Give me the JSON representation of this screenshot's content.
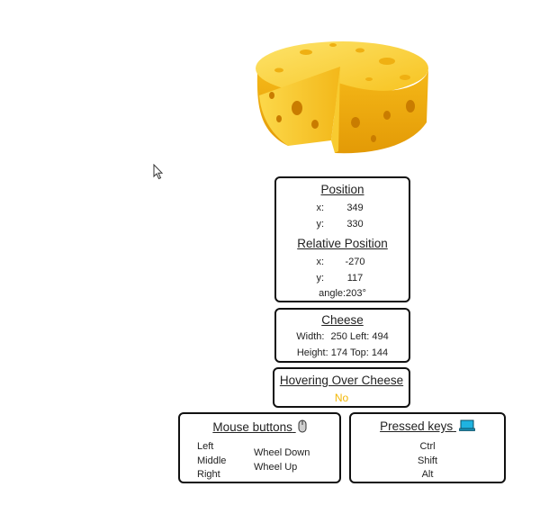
{
  "position": {
    "title": "Position",
    "x_label": "x:",
    "x": "349",
    "y_label": "y:",
    "y": "330"
  },
  "relative_position": {
    "title": "Relative Position",
    "x_label": "x:",
    "x": "-270",
    "y_label": "y:",
    "y": "117",
    "angle_label": "angle:",
    "angle": "203°"
  },
  "cheese": {
    "title": "Cheese",
    "width_label": "Width:",
    "width": "250",
    "left_label": "Left:",
    "left": "494",
    "height_label": "Height:",
    "height": "174",
    "top_label": "Top:",
    "top": "144"
  },
  "hover": {
    "title": "Hovering Over Cheese",
    "value": "No"
  },
  "mouse_buttons": {
    "title": "Mouse buttons",
    "icon": "mouse-icon",
    "left_column": [
      "Left",
      "Middle",
      "Right"
    ],
    "right_column": [
      "Wheel Down",
      "Wheel Up"
    ]
  },
  "pressed_keys": {
    "title": "Pressed keys",
    "icon": "keyboard-icon",
    "keys": [
      "Ctrl",
      "Shift",
      "Alt"
    ]
  },
  "colors": {
    "cheese_yellow": "#f7c21e",
    "hover_value": "#f2b705",
    "keyboard_icon": "#1fb3e0"
  }
}
